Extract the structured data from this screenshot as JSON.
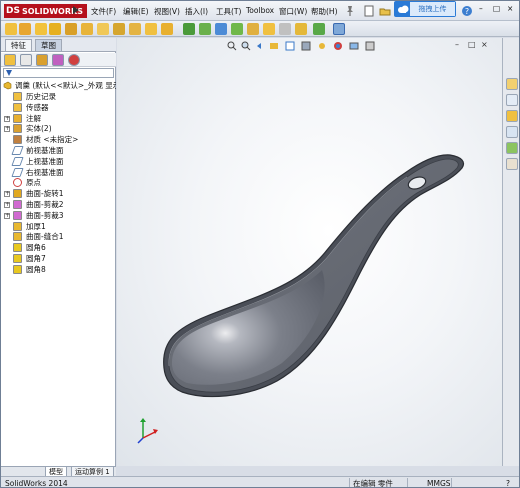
{
  "app": {
    "brand": "SOLIDWORKS",
    "brand_prefix": "DS"
  },
  "menu": {
    "items": [
      "文件(F)",
      "编辑(E)",
      "视图(V)",
      "插入(I)",
      "工具(T)",
      "Toolbox",
      "窗口(W)",
      "帮助(H)"
    ]
  },
  "upload": {
    "label": "拖拽上传"
  },
  "panel": {
    "tabs": [
      "特征",
      "草图"
    ],
    "active_tab": "草图",
    "bottom_tabs": [
      "模型",
      "运动算例 1"
    ]
  },
  "tree": {
    "root": "调羹  (默认<<默认>_外观 显示",
    "items": [
      {
        "label": "历史记录",
        "icon": "history-icon",
        "expandable": false
      },
      {
        "label": "传感器",
        "icon": "sensor-icon",
        "expandable": false
      },
      {
        "label": "注解",
        "icon": "annotation-icon",
        "expandable": true
      },
      {
        "label": "实体(2)",
        "icon": "solid-bodies-icon",
        "expandable": true
      },
      {
        "label": "材质 <未指定>",
        "icon": "material-icon",
        "expandable": false
      },
      {
        "label": "前视基准面",
        "icon": "plane-icon",
        "expandable": false
      },
      {
        "label": "上视基准面",
        "icon": "plane-icon",
        "expandable": false
      },
      {
        "label": "右视基准面",
        "icon": "plane-icon",
        "expandable": false
      },
      {
        "label": "原点",
        "icon": "origin-icon",
        "expandable": false
      },
      {
        "label": "曲面-旋转1",
        "icon": "surface-revolve-icon",
        "expandable": true
      },
      {
        "label": "曲面-剪裁2",
        "icon": "surface-trim-icon",
        "expandable": true
      },
      {
        "label": "曲面-剪裁3",
        "icon": "surface-trim-icon",
        "expandable": true
      },
      {
        "label": "加厚1",
        "icon": "thicken-icon",
        "expandable": false
      },
      {
        "label": "曲面-缝合1",
        "icon": "surface-knit-icon",
        "expandable": false
      },
      {
        "label": "圆角6",
        "icon": "fillet-icon",
        "expandable": false
      },
      {
        "label": "圆角7",
        "icon": "fillet-icon",
        "expandable": false
      },
      {
        "label": "圆角8",
        "icon": "fillet-icon",
        "expandable": false
      }
    ]
  },
  "status": {
    "version": "SolidWorks 2014",
    "mode": "在编辑 零件",
    "units": "MMGS"
  },
  "colors": {
    "brand_red": "#b5101c",
    "part_gray": "#6b6f78",
    "accent_blue": "#2a7ad6"
  }
}
